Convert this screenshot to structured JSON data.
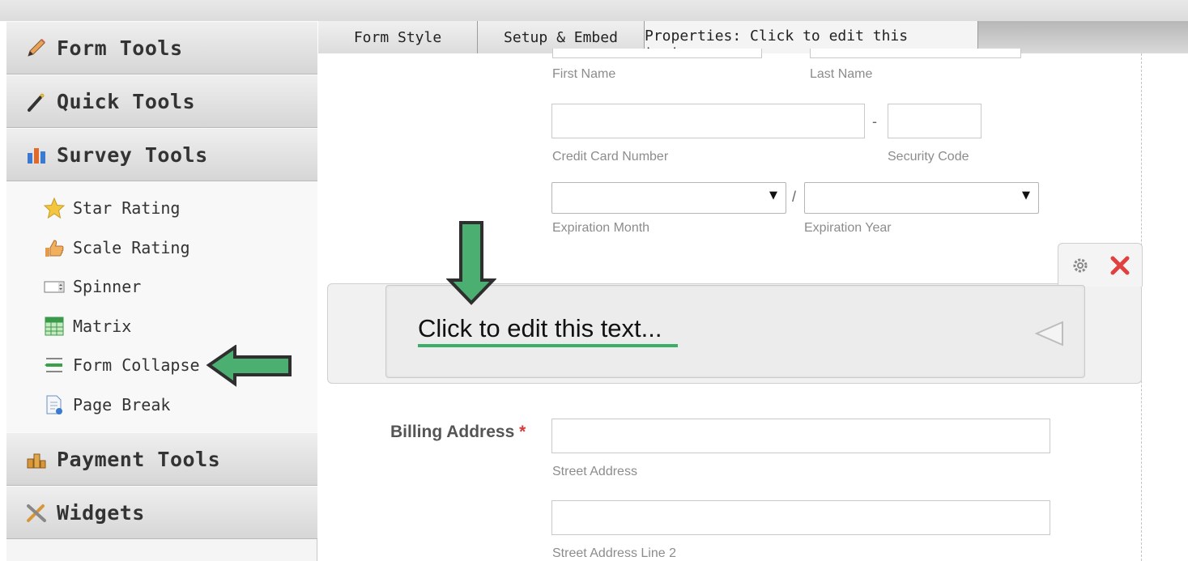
{
  "sidebar": {
    "categories": [
      {
        "label": "Form Tools",
        "icon": "pencil-icon"
      },
      {
        "label": "Quick Tools",
        "icon": "magic-wand-icon"
      },
      {
        "label": "Survey Tools",
        "icon": "bar-chart-icon"
      },
      {
        "label": "Payment Tools",
        "icon": "coins-icon"
      },
      {
        "label": "Widgets",
        "icon": "widget-tools-icon"
      }
    ],
    "survey_items": [
      {
        "label": "Star Rating",
        "icon": "star-icon"
      },
      {
        "label": "Scale Rating",
        "icon": "thumbs-up-icon"
      },
      {
        "label": "Spinner",
        "icon": "spinner-icon"
      },
      {
        "label": "Matrix",
        "icon": "matrix-grid-icon"
      },
      {
        "label": "Form Collapse",
        "icon": "form-collapse-icon"
      },
      {
        "label": "Page Break",
        "icon": "page-break-icon"
      }
    ]
  },
  "tabs": [
    {
      "label": "Form Style"
    },
    {
      "label": "Setup & Embed"
    },
    {
      "label": "Properties: Click to edit this text..."
    }
  ],
  "form": {
    "name": {
      "first_caption": "First Name",
      "last_caption": "Last Name"
    },
    "card": {
      "number_caption": "Credit Card Number",
      "security_caption": "Security Code",
      "separator": "-"
    },
    "expiration": {
      "month_caption": "Expiration Month",
      "year_caption": "Expiration Year",
      "separator": "/",
      "arrow": "▼"
    },
    "text_field": {
      "text": "Click to edit this text..."
    },
    "billing": {
      "label": "Billing Address",
      "required_mark": "*",
      "street_caption": "Street Address",
      "street2_caption": "Street Address Line 2"
    }
  },
  "colors": {
    "arrow_fill": "#4caf72",
    "arrow_stroke": "#2f2f2f",
    "underline": "#3cae6a",
    "delete": "#e04040"
  }
}
